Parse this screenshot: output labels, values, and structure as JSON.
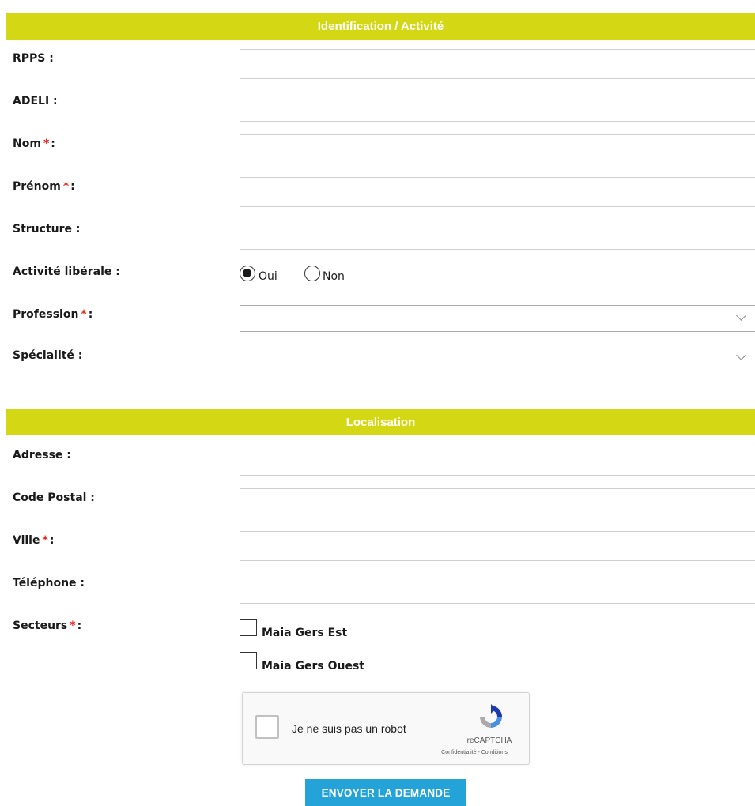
{
  "colors": {
    "header_bg": "#d4d814",
    "required_mark": "#e0261d",
    "submit_bg": "#24a3d9"
  },
  "sections": {
    "identification": {
      "title": "Identification / Activité"
    },
    "localisation": {
      "title": "Localisation"
    }
  },
  "required_mark": "*",
  "fields": {
    "rpps": {
      "label": "RPPS :",
      "value": ""
    },
    "adeli": {
      "label": "ADELI :",
      "value": ""
    },
    "nom": {
      "label": "Nom",
      "suffix": ":",
      "value": ""
    },
    "prenom": {
      "label": "Prénom",
      "suffix": ":",
      "value": ""
    },
    "structure": {
      "label": "Structure :",
      "value": ""
    },
    "activite_liberale": {
      "label": "Activité libérale :",
      "options": [
        "Oui",
        "Non"
      ],
      "selected": "Oui"
    },
    "profession": {
      "label": "Profession",
      "suffix": ":",
      "selected": ""
    },
    "specialite": {
      "label": "Spécialité :",
      "selected": ""
    },
    "adresse": {
      "label": "Adresse :",
      "value": ""
    },
    "code_postal": {
      "label": "Code Postal :",
      "value": ""
    },
    "ville": {
      "label": "Ville",
      "suffix": ":",
      "value": ""
    },
    "telephone": {
      "label": "Téléphone :",
      "value": ""
    },
    "secteurs": {
      "label": "Secteurs",
      "suffix": ":",
      "options": [
        "Maia Gers Est",
        "Maia Gers Ouest"
      ]
    }
  },
  "captcha": {
    "text": "Je ne suis pas un robot",
    "brand": "reCAPTCHA",
    "legal": "Confidentialité - Conditions",
    "icon": "recaptcha-logo-icon"
  },
  "submit_label": "ENVOYER LA DEMANDE"
}
